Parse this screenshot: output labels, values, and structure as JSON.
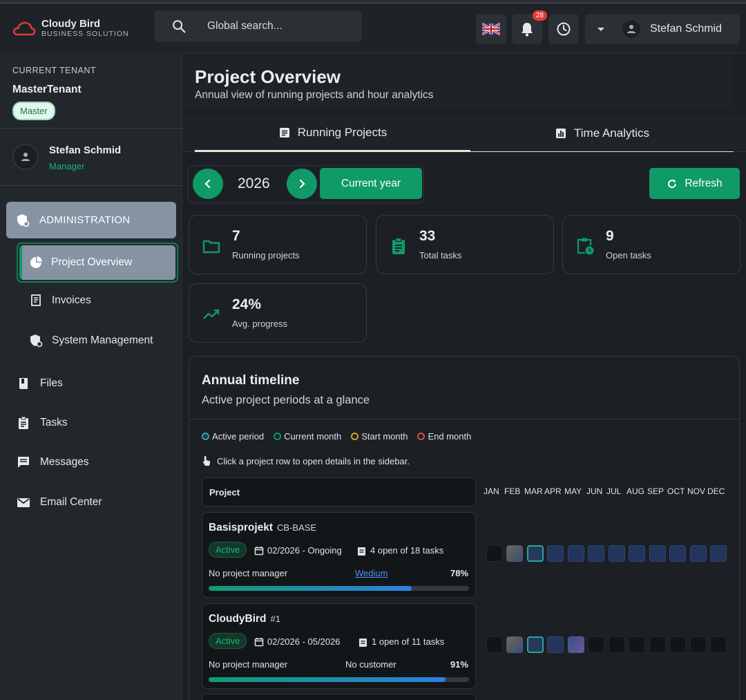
{
  "app": {
    "brand_name": "Cloudy Bird",
    "brand_sub": "BUSINESS SOLUTION",
    "accent_color": "#0f9a68"
  },
  "header": {
    "search_placeholder": "Global search...",
    "notifications_count": "28",
    "user_name": "Stefan Schmid",
    "language_icon": "uk-flag-icon"
  },
  "sidebar": {
    "tenant_label": "CURRENT TENANT",
    "tenant_name": "MasterTenant",
    "tenant_chip": "Master",
    "user_name": "Stefan Schmid",
    "user_role": "Manager",
    "section": "ADMINISTRATION",
    "sub_items": [
      {
        "label": "Project Overview",
        "active": true
      },
      {
        "label": "Invoices"
      },
      {
        "label": "System Management"
      }
    ],
    "items": [
      {
        "label": "Files"
      },
      {
        "label": "Tasks"
      },
      {
        "label": "Messages"
      },
      {
        "label": "Email Center"
      }
    ]
  },
  "page": {
    "title": "Project Overview",
    "subtitle": "Annual view of running projects and hour analytics",
    "tabs": [
      {
        "label": "Running Projects",
        "active": true
      },
      {
        "label": "Time Analytics"
      }
    ],
    "year": "2026",
    "current_year_label": "Current year",
    "refresh_label": "Refresh"
  },
  "stats": [
    {
      "value": "7",
      "label": "Running projects",
      "icon": "folder-icon"
    },
    {
      "value": "33",
      "label": "Total tasks",
      "icon": "clipboard-icon"
    },
    {
      "value": "9",
      "label": "Open tasks",
      "icon": "clipboard-clock-icon"
    },
    {
      "value": "24%",
      "label": "Avg. progress",
      "icon": "trending-up-icon"
    }
  ],
  "timeline": {
    "title": "Annual timeline",
    "subtitle": "Active project periods at a glance",
    "legend": [
      {
        "label": "Active period",
        "color": "#2aa59f"
      },
      {
        "label": "Current month",
        "color": "#0f9a68"
      },
      {
        "label": "Start month",
        "color": "#d4a017"
      },
      {
        "label": "End month",
        "color": "#d84a4a"
      }
    ],
    "hint": "Click a project row to open details in the sidebar.",
    "column_header": "Project",
    "months": [
      "JAN",
      "FEB",
      "MAR",
      "APR",
      "MAY",
      "JUN",
      "JUL",
      "AUG",
      "SEP",
      "OCT",
      "NOV",
      "DEC"
    ],
    "projects": [
      {
        "name": "Basisprojekt",
        "code": "CB-BASE",
        "status": "Active",
        "period": "02/2026 - Ongoing",
        "tasks": "4 open of 18 tasks",
        "manager": "No project manager",
        "customer": "Wedium",
        "progress": "78%",
        "progress_value": 0.78,
        "cells": [
          "none",
          "start",
          "current",
          "active",
          "active",
          "active",
          "active",
          "active",
          "active",
          "active",
          "active",
          "active"
        ]
      },
      {
        "name": "CloudyBird",
        "code": "#1",
        "status": "Active",
        "period": "02/2026 - 05/2026",
        "tasks": "1 open of 11 tasks",
        "manager": "No project manager",
        "customer": "No customer",
        "progress": "91%",
        "progress_value": 0.91,
        "cells": [
          "none",
          "start",
          "current",
          "active",
          "end",
          "none",
          "none",
          "none",
          "none",
          "none",
          "none",
          "none"
        ]
      }
    ]
  }
}
